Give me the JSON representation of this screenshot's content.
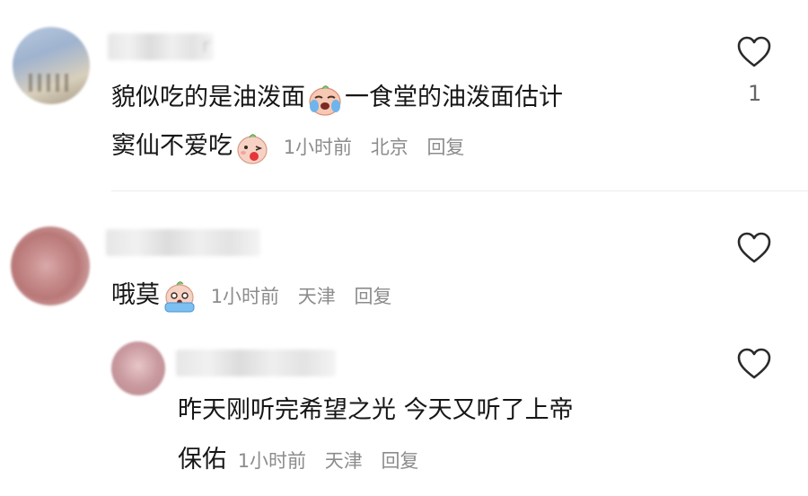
{
  "comments": [
    {
      "username_visible": "r",
      "text_line1": "貌似吃的是油泼面",
      "text_line1_after_emoji": "一食堂的油泼面估计",
      "text_line2": "窦仙不爱吃",
      "time": "1小时前",
      "location": "北京",
      "reply_label": "回复",
      "like_count": "1",
      "emoji1": "crying-face-emoji",
      "emoji2": "kiss-face-emoji"
    },
    {
      "text": "哦莫",
      "time": "1小时前",
      "location": "天津",
      "reply_label": "回复",
      "emoji": "shocked-face-emoji"
    },
    {
      "text_line1": "昨天刚听完希望之光 今天又听了上帝",
      "text_line2": "保佑",
      "time": "1小时前",
      "location": "天津",
      "reply_label": "回复"
    }
  ],
  "colors": {
    "text": "#161616",
    "meta": "#8c8c8c",
    "heart_stroke": "#2a2a2a"
  }
}
